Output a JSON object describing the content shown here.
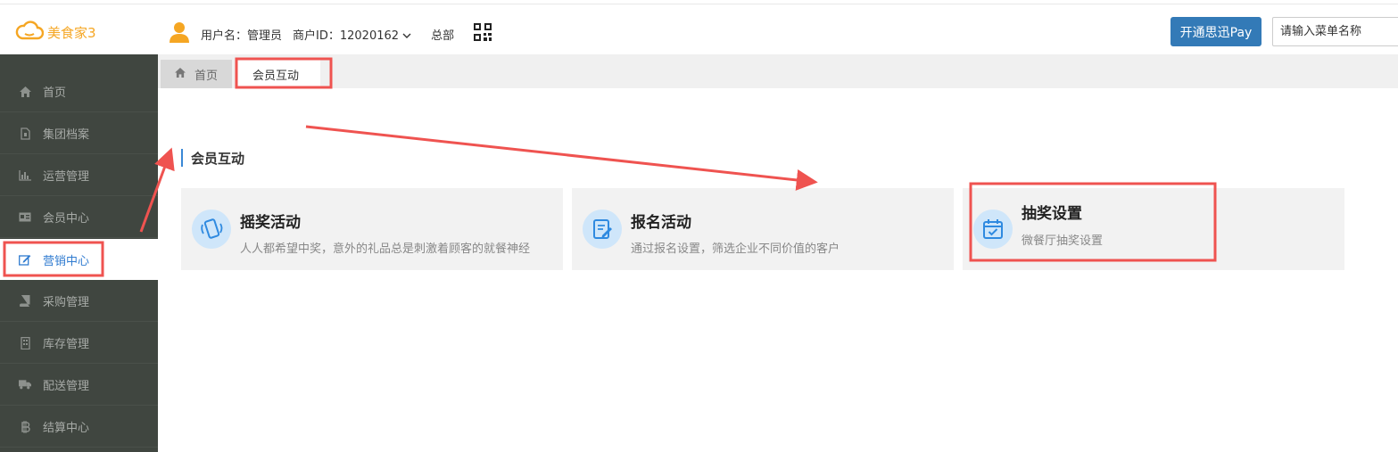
{
  "app": {
    "logo_text": "美食家3"
  },
  "header": {
    "user_label": "用户名：管理员",
    "merchant_label": "商户ID：12020162",
    "store": "总部",
    "pay_button": "开通思迅Pay",
    "search_placeholder": "请输入菜单名称"
  },
  "sidebar": {
    "items": [
      {
        "label": "首页",
        "icon": "home-icon"
      },
      {
        "label": "集团档案",
        "icon": "file-icon"
      },
      {
        "label": "运营管理",
        "icon": "bar-chart-icon"
      },
      {
        "label": "会员中心",
        "icon": "id-card-icon"
      },
      {
        "label": "营销中心",
        "icon": "edit-icon",
        "active": true
      },
      {
        "label": "采购管理",
        "icon": "book-icon"
      },
      {
        "label": "库存管理",
        "icon": "building-icon"
      },
      {
        "label": "配送管理",
        "icon": "truck-icon"
      },
      {
        "label": "结算中心",
        "icon": "bitcoin-icon"
      }
    ]
  },
  "tabs": [
    {
      "label": "首页",
      "icon": "home-icon"
    },
    {
      "label": "会员互动",
      "active": true
    }
  ],
  "section": {
    "title": "会员互动",
    "cards": [
      {
        "title": "摇奖活动",
        "desc": "人人都希望中奖，意外的礼品总是刺激着顾客的就餐神经",
        "icon": "phone-shake-icon"
      },
      {
        "title": "报名活动",
        "desc": "通过报名设置，筛选企业不同价值的客户",
        "icon": "form-edit-icon"
      },
      {
        "title": "抽奖设置",
        "desc": "微餐厅抽奖设置",
        "icon": "calendar-check-icon"
      }
    ]
  },
  "colors": {
    "accent": "#337ab7",
    "sidebar_bg": "#404640",
    "active_text": "#2f7bd0",
    "logo": "#f5a623",
    "annotation": "#ef5350"
  }
}
